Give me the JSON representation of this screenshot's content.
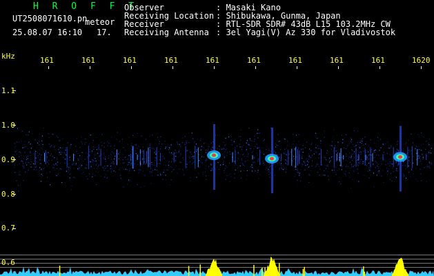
{
  "header": {
    "app_name": "H R O F F T",
    "file_name": "UT2508071610.pn",
    "meteor_label": "meteor",
    "date_time": "25.08.07 16:10",
    "count": "17.",
    "fields": [
      {
        "label": "Observer",
        "value": ": Masaki Kano"
      },
      {
        "label": "Receiving Location",
        "value": ": Shibukawa, Gunma, Japan"
      },
      {
        "label": "Receiver",
        "value": ": RTL-SDR SDR# 43dB L15 103.2MHz CW"
      },
      {
        "label": "Receiving Antenna",
        "value": ": 3el Yagi(V) Az 330 for Vladivostok"
      }
    ]
  },
  "axes": {
    "y_unit": "kHz",
    "y_ticks": [
      "1.1",
      "1.0",
      "0.9",
      "0.8",
      "0.7",
      "0.6"
    ],
    "x_ticks": [
      "161",
      "161",
      "161",
      "161",
      "161",
      "161",
      "161",
      "161",
      "161",
      "1620"
    ]
  },
  "colors": {
    "text": "#ffffff",
    "accent_green": "#00ff44",
    "tick_yellow": "#ffff33",
    "baseline_cyan": "#33ccff",
    "echo_yellow": "#ffff00"
  },
  "echoes": [
    {
      "minute": 15.0,
      "freq": 0.91
    },
    {
      "minute": 16.4,
      "freq": 0.9
    },
    {
      "minute": 19.5,
      "freq": 0.905
    }
  ]
}
